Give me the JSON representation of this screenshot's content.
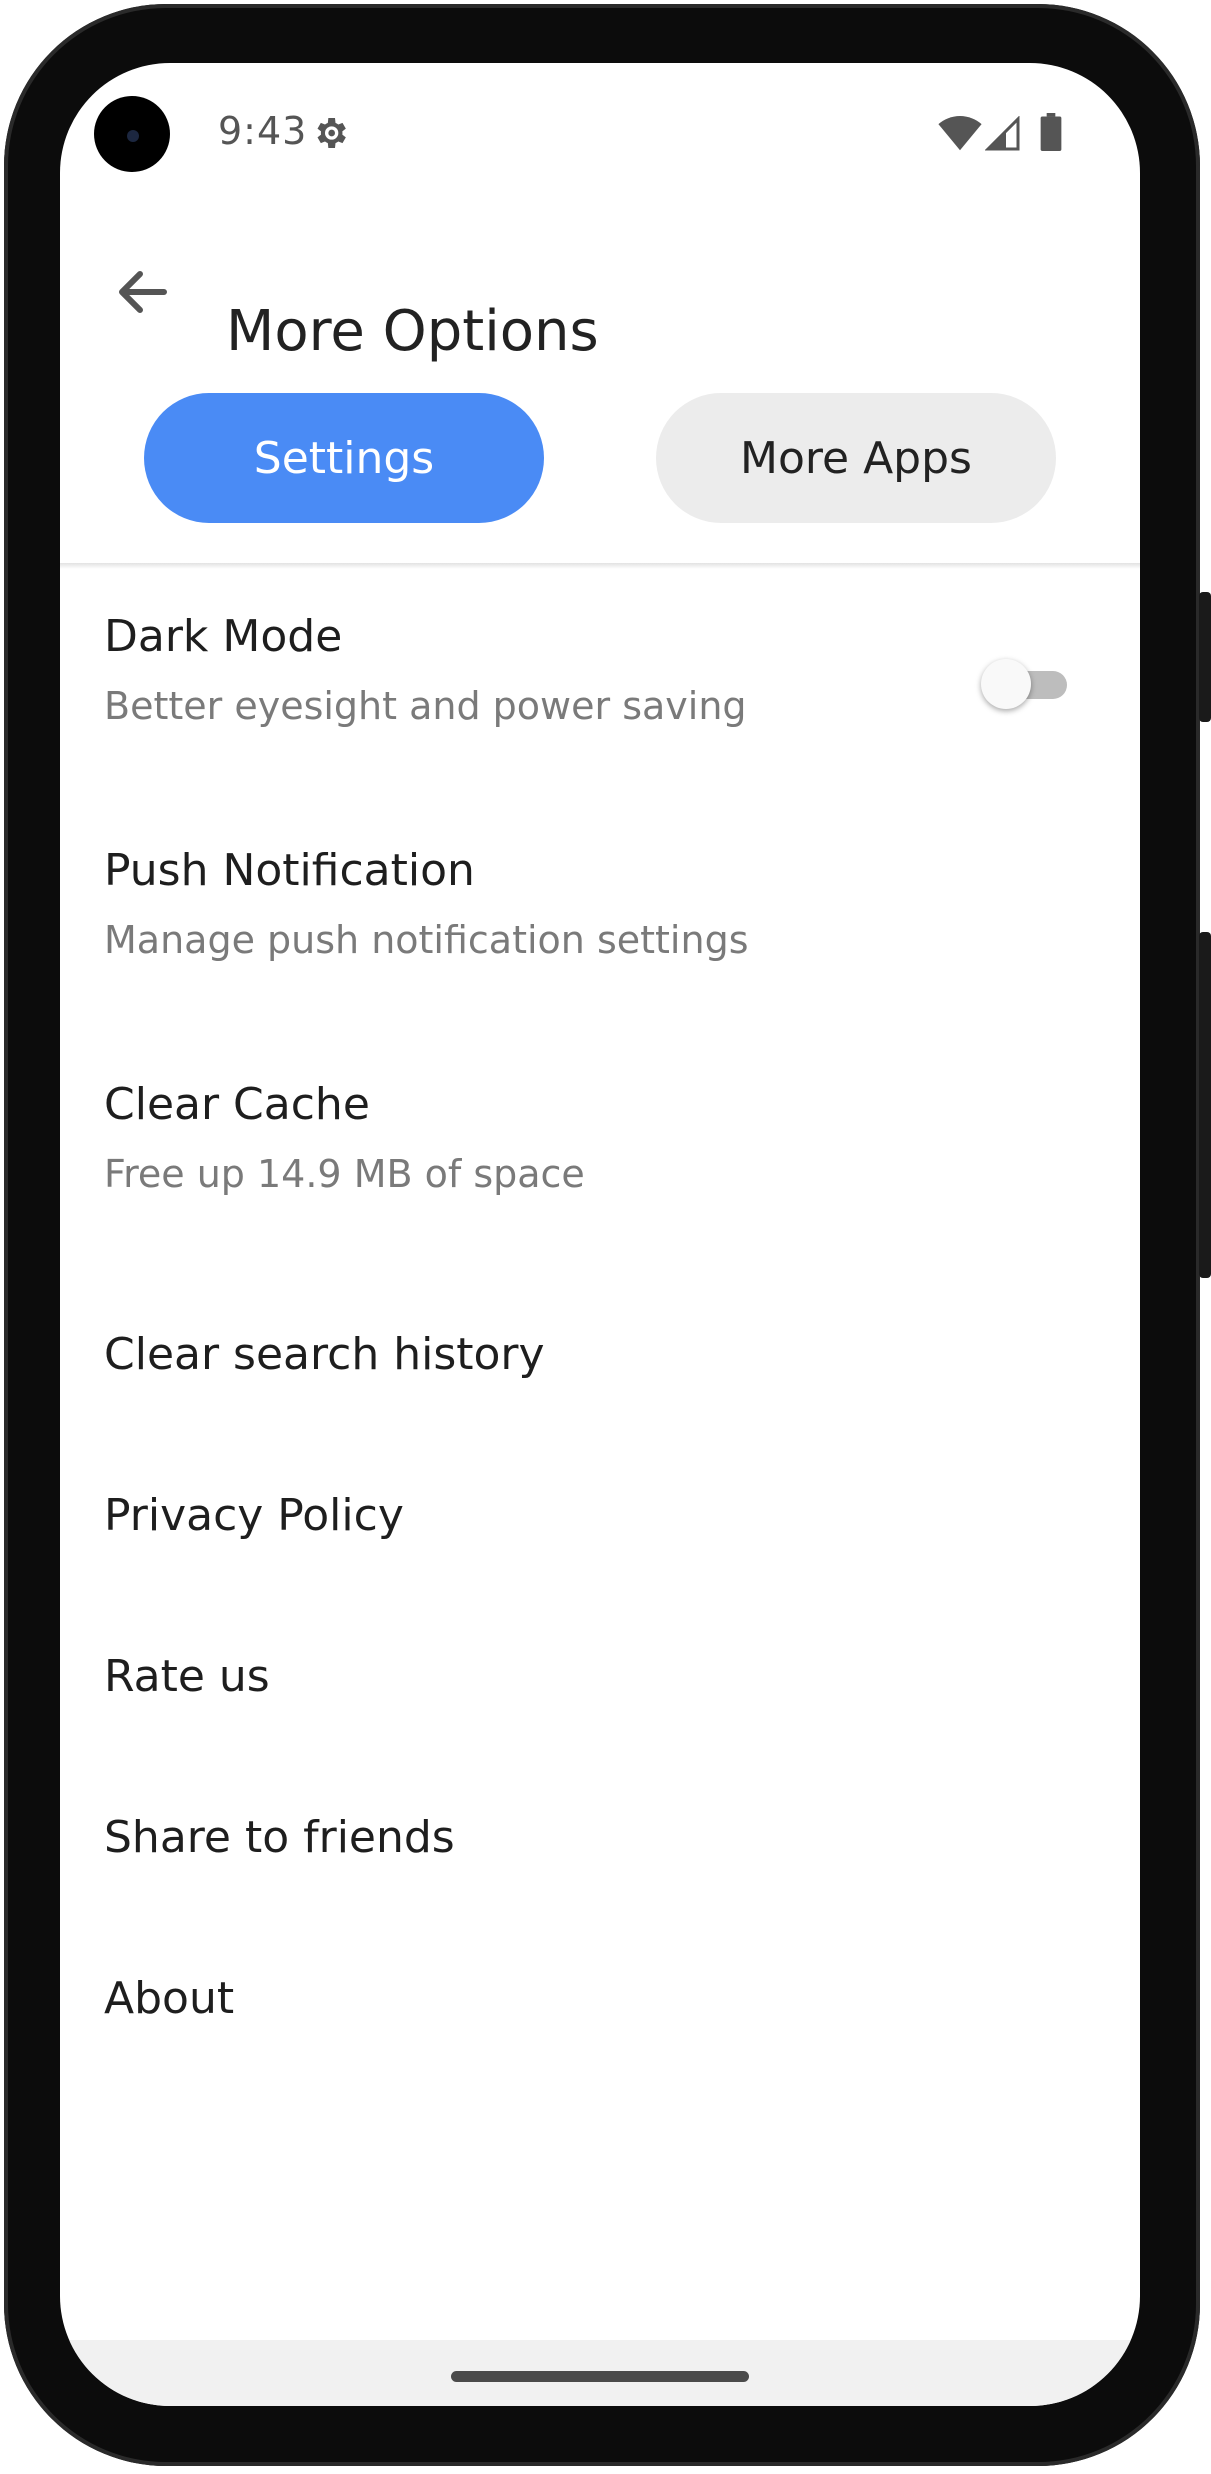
{
  "status_bar": {
    "time": "9:43",
    "icons": [
      "gear-icon",
      "wifi-icon",
      "signal-icon",
      "battery-icon"
    ]
  },
  "app_bar": {
    "back_icon": "back-arrow-icon",
    "title": "More Options"
  },
  "tabs": [
    {
      "label": "Settings",
      "active": true
    },
    {
      "label": "More Apps",
      "active": false
    }
  ],
  "colors": {
    "accent": "#4a8bf5",
    "inactive_tab": "#ececec",
    "title_text": "#1e1e1e",
    "subtitle_text": "#7a7a7a"
  },
  "settings": {
    "items": [
      {
        "title": "Dark Mode",
        "subtitle": "Better eyesight and power saving",
        "toggle_on": false
      },
      {
        "title": "Push Notification",
        "subtitle": "Manage push notification settings"
      },
      {
        "title": "Clear Cache",
        "subtitle": "Free up 14.9 MB of space"
      },
      {
        "title": "Clear search history"
      },
      {
        "title": "Privacy Policy"
      },
      {
        "title": "Rate us"
      },
      {
        "title": "Share to friends"
      },
      {
        "title": "About"
      }
    ]
  }
}
